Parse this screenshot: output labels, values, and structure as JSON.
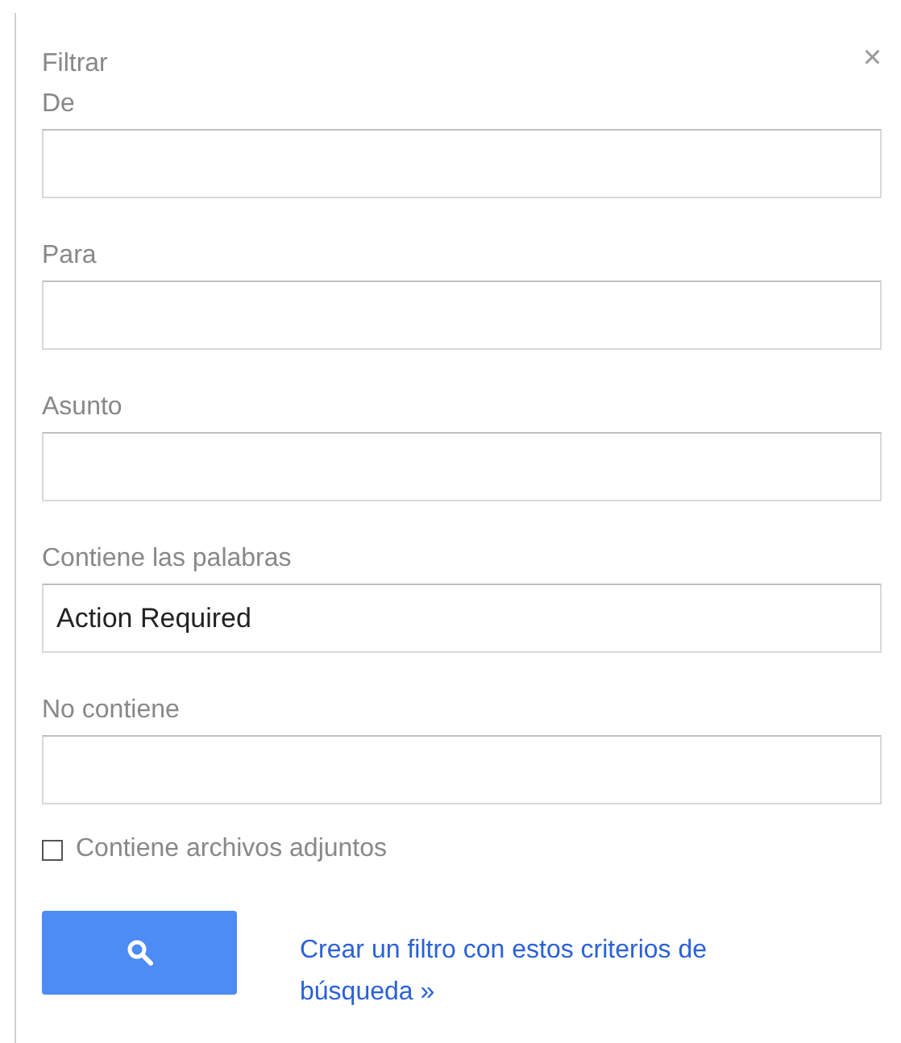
{
  "title": "Filtrar",
  "close": "×",
  "fields": [
    {
      "label": "De"
    },
    {
      "label": "Para"
    },
    {
      "label": "Asunto"
    },
    {
      "label": "Contiene las palabras",
      "value": "Action Required"
    },
    {
      "label": "No contiene"
    }
  ],
  "attachments": {
    "label": "Contiene archivos adjuntos",
    "checked": false
  },
  "create_filter_link": "Crear un filtro con estos criterios de búsqueda »"
}
